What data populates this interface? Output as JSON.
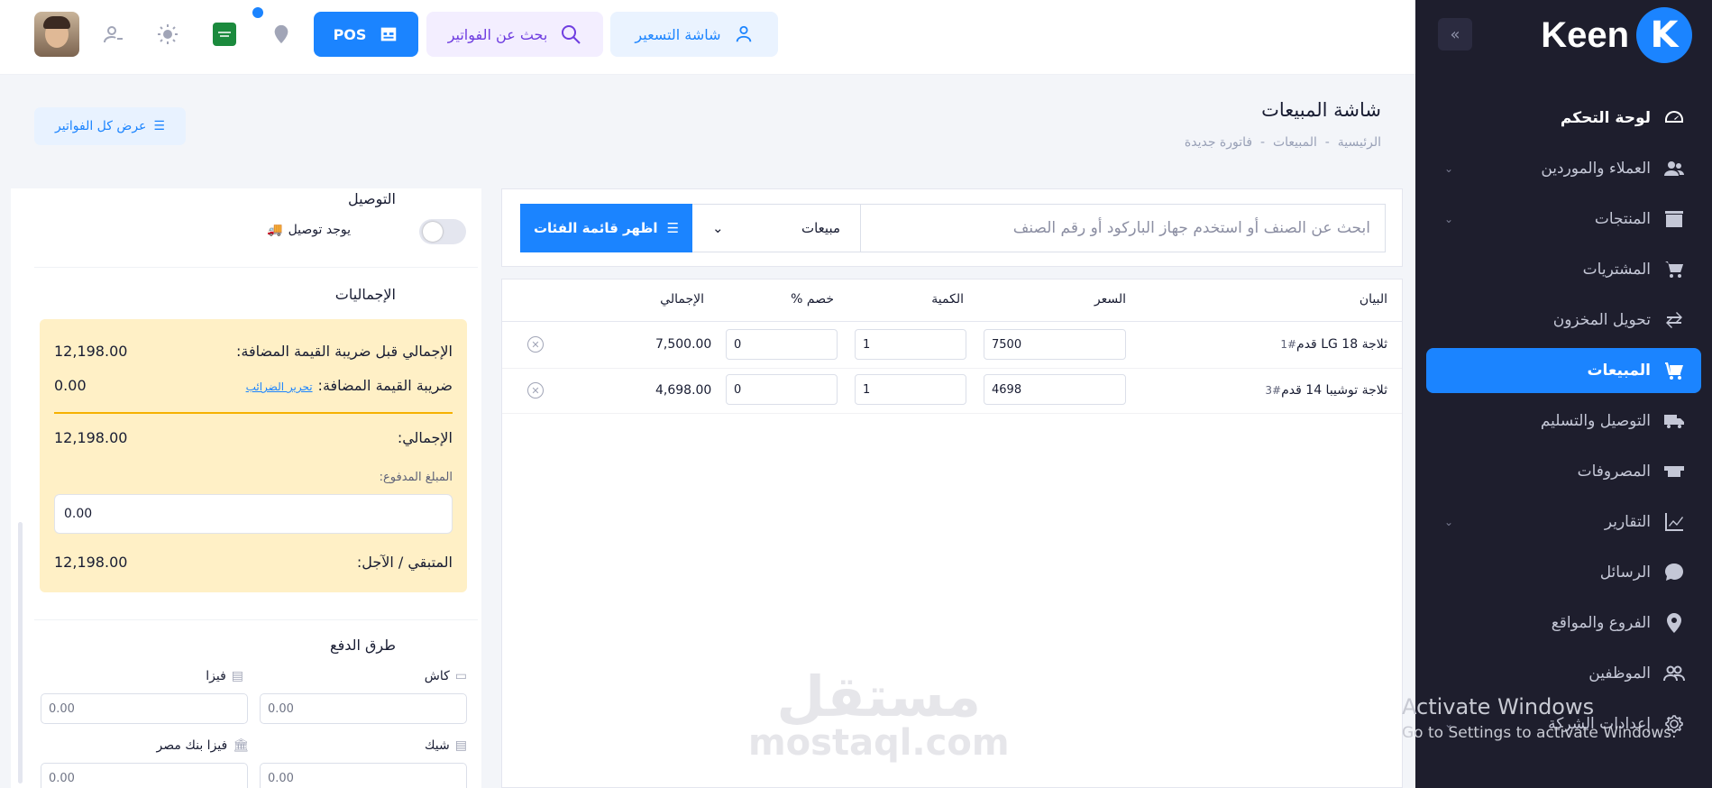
{
  "sidebar": {
    "logo_text": "Keen",
    "collapse_icon": "double-chevron-icon",
    "items": [
      {
        "label": "لوحة التحكم",
        "icon": "dashboard-icon"
      },
      {
        "label": "العملاء والموردين",
        "icon": "users-icon"
      },
      {
        "label": "المنتجات",
        "icon": "box-icon"
      },
      {
        "label": "المشتريات",
        "icon": "cart-icon"
      },
      {
        "label": "تحويل المخزون",
        "icon": "transfer-icon"
      },
      {
        "label": "المبيعات",
        "icon": "cart-icon"
      },
      {
        "label": "التوصيل والتسليم",
        "icon": "truck-icon"
      },
      {
        "label": "المصروفات",
        "icon": "expense-icon"
      },
      {
        "label": "التقارير",
        "icon": "chart-icon"
      },
      {
        "label": "الرسائل",
        "icon": "chat-icon"
      },
      {
        "label": "الفروع والمواقع",
        "icon": "location-icon"
      },
      {
        "label": "الموظفين",
        "icon": "team-icon"
      },
      {
        "label": "إعدادات الشركة",
        "icon": "gear-icon"
      }
    ]
  },
  "topbar": {
    "pricing": "شاشة التسعير",
    "invoice_search": "بحث عن الفواتير",
    "pos": "POS"
  },
  "page": {
    "title": "شاشة المبيعات",
    "crumb_home": "الرئيسية",
    "crumb_sales": "المبيعات",
    "crumb_new": "فاتورة جديدة",
    "sep": "-",
    "all_invoices": "عرض كل الفواتير"
  },
  "delivery": {
    "title": "التوصيل",
    "toggle_label": "يوجد توصيل",
    "enabled": false
  },
  "totals": {
    "title": "الإجماليات",
    "pre_vat_label": "الإجمالي قبل ضريبة القيمة المضافة:",
    "pre_vat": "12,198.00",
    "vat_label": "ضريبة القيمة المضافة:",
    "vat_link": "تحرير الضرائب",
    "vat": "0.00",
    "total_label": "الإجمالي:",
    "total": "12,198.00",
    "paid_label": "المبلغ المدفوع:",
    "paid": "0.00",
    "remaining_label": "المتبقي / الآجل:",
    "remaining": "12,198.00"
  },
  "payment": {
    "title": "طرق الدفع",
    "cash": "كاش",
    "visa": "فيزا",
    "cheque": "شيك",
    "visa_misr": "فيزا بنك مصر",
    "cash_val": "0.00",
    "visa_val": "0.00",
    "cheque_val": "0.00",
    "visa_misr_val": "0.00"
  },
  "search": {
    "placeholder": "ابحث عن الصنف أو استخدم جهاز الباركود أو رقم الصنف",
    "type": "مبيعات",
    "categories_btn": "اظهر قائمة الفئات"
  },
  "table": {
    "headers": {
      "desc": "البيان",
      "price": "السعر",
      "qty": "الكمية",
      "discount": "خصم %",
      "total": "الإجمالي"
    },
    "rows": [
      {
        "name": "ثلاجة LG 18 قدم",
        "id": "#1",
        "price": "7500",
        "qty": "1",
        "discount": "0",
        "total": "7,500.00"
      },
      {
        "name": "ثلاجة توشيبا 14 قدم",
        "id": "#3",
        "price": "4698",
        "qty": "1",
        "discount": "0",
        "total": "4,698.00"
      }
    ]
  },
  "watermark": {
    "ar": "مستقل",
    "en": "mostaql.com"
  },
  "os": {
    "activate_title": "Activate Windows",
    "activate_sub": "Go to Settings to activate Windows."
  }
}
